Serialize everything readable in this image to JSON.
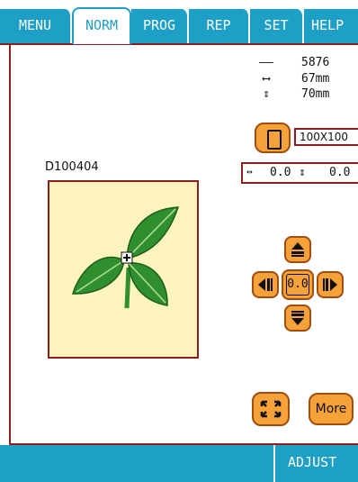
{
  "tabs": [
    {
      "label": "MENU",
      "active": false
    },
    {
      "label": "NORM",
      "active": true
    },
    {
      "label": "PROG",
      "active": false
    },
    {
      "label": "REP",
      "active": false
    },
    {
      "label": "SET",
      "active": false
    },
    {
      "label": "HELP",
      "active": false
    }
  ],
  "stats": {
    "stitches": "5876",
    "width": "67mm",
    "height": "70mm"
  },
  "hoop": {
    "size_label": "100X100"
  },
  "offset": {
    "x": "0.0",
    "y": "0.0"
  },
  "design": {
    "name": "D100404"
  },
  "controls": {
    "center_label": "0.0",
    "more_label": "More"
  },
  "status": {
    "adjust_label": "ADJUST"
  },
  "colors": {
    "tab_blue": "#1e9fc6",
    "frame_red": "#8f1e1e",
    "button_orange": "#f6a23a",
    "design_bg": "#fdf4bd",
    "leaf_green": "#2f8f2f"
  },
  "icons": {
    "stitch": "stitch-count-icon",
    "width": "width-arrow-icon",
    "height": "height-arrow-icon",
    "hoop": "hoop-icon",
    "fit": "fit-screen-icon"
  }
}
